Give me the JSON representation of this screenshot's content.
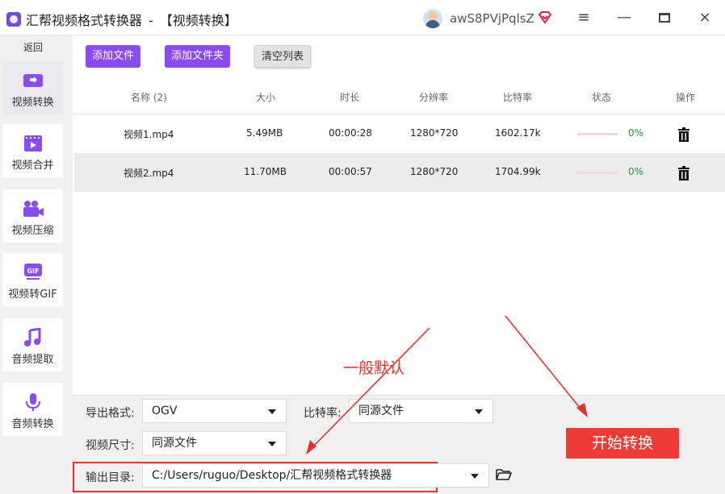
{
  "titlebar": {
    "app_title": "汇帮视频格式转换器",
    "separator": "-",
    "section": "【视频转换】",
    "user_name": "awS8PVjPqlsZ",
    "vip_icon": "diamond-heart-icon",
    "menu_symbol": "≡",
    "minimize_symbol": "—",
    "close_symbol": "×"
  },
  "sidebar": {
    "back_label": "返回",
    "items": [
      {
        "label": "视频转换",
        "icon": "video-convert-icon",
        "active": true
      },
      {
        "label": "视频合并",
        "icon": "video-merge-icon",
        "active": false
      },
      {
        "label": "视频压缩",
        "icon": "camera-compress-icon",
        "active": false
      },
      {
        "label": "视频转GIF",
        "icon": "gif-icon",
        "active": false
      },
      {
        "label": "音频提取",
        "icon": "music-note-icon",
        "active": false
      },
      {
        "label": "音频转换",
        "icon": "microphone-icon",
        "active": false
      }
    ]
  },
  "toolbar": {
    "add_file": "添加文件",
    "add_folder": "添加文件夹",
    "clear_list": "清空列表"
  },
  "table": {
    "headers": {
      "name": "名称 (2)",
      "size": "大小",
      "duration": "时长",
      "resolution": "分辨率",
      "bitrate": "比特率",
      "status": "状态",
      "action": "操作"
    },
    "rows": [
      {
        "name": "视频1.mp4",
        "size": "5.49MB",
        "duration": "00:00:28",
        "resolution": "1280*720",
        "bitrate": "1602.17k",
        "progress_text": "0%",
        "progress": 0
      },
      {
        "name": "视频2.mp4",
        "size": "11.70MB",
        "duration": "00:00:57",
        "resolution": "1280*720",
        "bitrate": "1704.99k",
        "progress_text": "0%",
        "progress": 0
      }
    ]
  },
  "settings": {
    "format_label": "导出格式:",
    "format_value": "OGV",
    "bitrate_label": "比特率:",
    "bitrate_value": "同源文件",
    "size_label": "视频尺寸:",
    "size_value": "同源文件",
    "output_label": "输出目录:",
    "output_value": "C:/Users/ruguo/Desktop/汇帮视频格式转换器",
    "start_button": "开始转换"
  },
  "annotations": {
    "note": "一般默认",
    "color": "#e6332a"
  },
  "colors": {
    "accent": "#8a4cf0",
    "start": "#ef3b36",
    "progress_done": "#1a9b2a"
  }
}
